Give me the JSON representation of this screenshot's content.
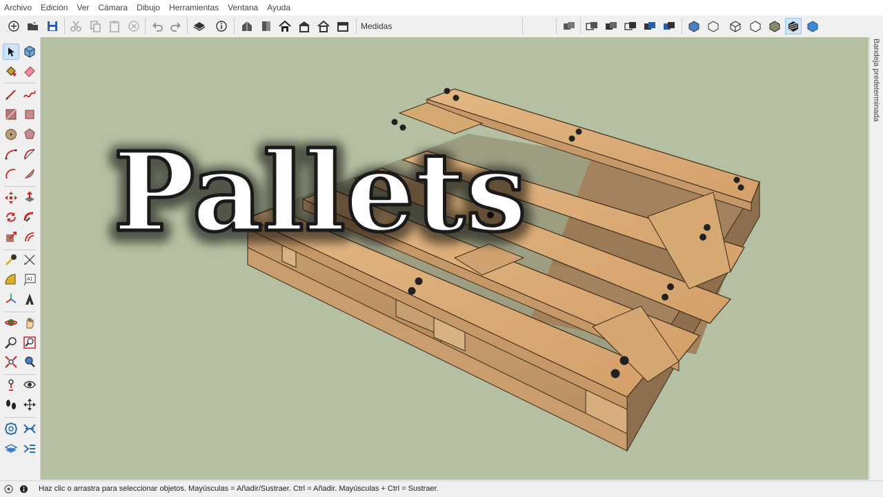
{
  "menu": [
    "Archivo",
    "Edición",
    "Ver",
    "Cámara",
    "Dibujo",
    "Herramientas",
    "Ventana",
    "Ayuda"
  ],
  "toolbar": {
    "measurements_label": "Medidas"
  },
  "tray": {
    "label": "Bandeja predeterminada"
  },
  "status": {
    "hint": "Haz clic o arrastra para seleccionar objetos. Mayúsculas = Añadir/Sustraer. Ctrl = Añadir. Mayúsculas + Ctrl = Sustraer."
  },
  "overlay": {
    "title": "Pallets"
  },
  "colors": {
    "background": "#b5c0a2",
    "wood": "#d8aa72",
    "title_fill": "#ffffff"
  }
}
